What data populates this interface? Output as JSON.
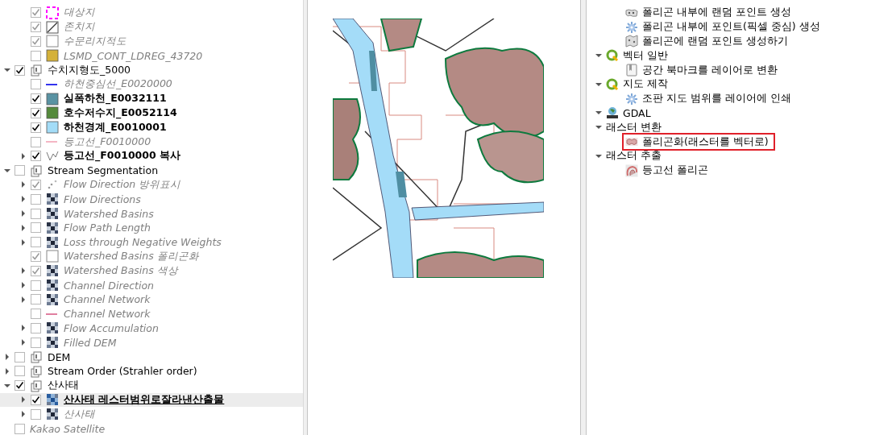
{
  "layers_panel": {
    "orphan_layers": [
      {
        "label": "대상지",
        "checked": true,
        "visible": false,
        "selected": false,
        "kind": "dashed",
        "color": "#ff00ff"
      },
      {
        "label": "존치지",
        "checked": true,
        "visible": false,
        "selected": false,
        "kind": "hatch"
      },
      {
        "label": "수문리지적도",
        "checked": true,
        "visible": false,
        "selected": false,
        "kind": "empty"
      },
      {
        "label": "LSMD_CONT_LDREG_43720",
        "checked": false,
        "visible": false,
        "selected": false,
        "kind": "fill",
        "color": "#d4b13a"
      }
    ],
    "tree": [
      {
        "label": "수치지형도_5000",
        "checked": true,
        "visible": true,
        "selected": false,
        "kind": "group",
        "expanded": true,
        "children": [
          {
            "label": "하천중심선_E0020000",
            "checked": false,
            "visible": false,
            "selected": false,
            "kind": "line",
            "color": "#3333ee"
          },
          {
            "label": "실폭하천_E0032111",
            "checked": true,
            "visible": true,
            "selected": false,
            "kind": "fill",
            "color": "#5a93a3"
          },
          {
            "label": "호수저수지_E0052114",
            "checked": true,
            "visible": true,
            "selected": false,
            "kind": "fill",
            "color": "#558a3c"
          },
          {
            "label": "하천경계_E0010001",
            "checked": true,
            "visible": true,
            "selected": false,
            "kind": "fill",
            "color": "#a3dcf7"
          },
          {
            "label": "등고선_F0010000",
            "checked": false,
            "visible": false,
            "selected": false,
            "kind": "line",
            "color": "#f4b6c4"
          },
          {
            "label": "등고선_F0010000 복사",
            "checked": true,
            "visible": true,
            "selected": false,
            "kind": "contour",
            "expanded": false
          }
        ]
      },
      {
        "label": "Stream Segmentation",
        "checked": false,
        "visible": true,
        "selected": false,
        "kind": "group",
        "expanded": true,
        "children": [
          {
            "label": "Flow Direction 방위표시",
            "checked": true,
            "visible": false,
            "selected": false,
            "kind": "points",
            "expanded": false
          },
          {
            "label": "Flow Directions",
            "checked": false,
            "visible": false,
            "selected": false,
            "kind": "raster",
            "expanded": false
          },
          {
            "label": "Watershed Basins",
            "checked": false,
            "visible": false,
            "selected": false,
            "kind": "raster",
            "expanded": false
          },
          {
            "label": "Flow Path Length",
            "checked": false,
            "visible": false,
            "selected": false,
            "kind": "raster",
            "expanded": false
          },
          {
            "label": "Loss through Negative Weights",
            "checked": false,
            "visible": false,
            "selected": false,
            "kind": "raster",
            "expanded": false
          },
          {
            "label": "Watershed Basins 폴리곤화",
            "checked": true,
            "visible": false,
            "selected": false,
            "kind": "empty"
          },
          {
            "label": "Watershed Basins 색상",
            "checked": true,
            "visible": false,
            "selected": false,
            "kind": "raster",
            "expanded": false
          },
          {
            "label": "Channel Direction",
            "checked": false,
            "visible": false,
            "selected": false,
            "kind": "raster",
            "expanded": false
          },
          {
            "label": "Channel Network",
            "checked": false,
            "visible": false,
            "selected": false,
            "kind": "raster",
            "expanded": false
          },
          {
            "label": "Channel Network",
            "checked": false,
            "visible": false,
            "selected": false,
            "kind": "line",
            "color": "#e07fa0"
          },
          {
            "label": "Flow Accumulation",
            "checked": false,
            "visible": false,
            "selected": false,
            "kind": "raster",
            "expanded": false
          },
          {
            "label": "Filled DEM",
            "checked": false,
            "visible": false,
            "selected": false,
            "kind": "raster",
            "expanded": false
          }
        ]
      },
      {
        "label": "DEM",
        "checked": false,
        "visible": true,
        "selected": false,
        "kind": "group",
        "expanded": false
      },
      {
        "label": "Stream Order (Strahler order)",
        "checked": false,
        "visible": true,
        "selected": false,
        "kind": "group",
        "expanded": false
      },
      {
        "label": "산사태",
        "checked": true,
        "visible": true,
        "selected": false,
        "kind": "group",
        "expanded": true,
        "children": [
          {
            "label": "산사태 레스터범위로잘라낸산출물",
            "checked": true,
            "visible": true,
            "selected": true,
            "kind": "bluegrid",
            "expanded": false
          },
          {
            "label": "산사태",
            "checked": false,
            "visible": false,
            "selected": false,
            "kind": "raster",
            "expanded": false
          }
        ]
      },
      {
        "label": "Kakao Satellite",
        "checked": false,
        "visible": false,
        "selected": false,
        "kind": "plain"
      }
    ]
  },
  "toolbox": {
    "orphan_tools": [
      {
        "kind": "dots",
        "label": "폴리곤 내부에 랜덤 포인트 생성",
        "highlighted": false
      },
      {
        "kind": "gear",
        "label": "폴리곤 내부에 포인트(픽셀 중심) 생성",
        "highlighted": false
      },
      {
        "kind": "map",
        "label": "폴리곤에 랜덤 포인트 생성하기",
        "highlighted": false
      }
    ],
    "providers": [
      {
        "label": "벡터 일반",
        "kind": "qgis",
        "expanded": true,
        "children": [
          {
            "kind": "bookmark",
            "label": "공간 북마크를 레이어로 변환",
            "highlighted": false
          }
        ]
      },
      {
        "label": "지도 제작",
        "kind": "qgis",
        "expanded": true,
        "children": [
          {
            "kind": "gear",
            "label": "조판 지도 범위를 레이어에 인쇄",
            "highlighted": false
          }
        ]
      },
      {
        "label": "GDAL",
        "kind": "gdal",
        "expanded": true,
        "children": [
          {
            "kind": "group",
            "label": "래스터 변환",
            "expanded": true,
            "children": [
              {
                "kind": "polygonize",
                "label": "폴리곤화(래스터를 벡터로)",
                "highlighted": true
              }
            ]
          },
          {
            "kind": "group",
            "label": "래스터 추출",
            "expanded": true,
            "children": [
              {
                "kind": "contour",
                "label": "등고선 폴리곤",
                "highlighted": false
              }
            ]
          }
        ]
      }
    ]
  }
}
